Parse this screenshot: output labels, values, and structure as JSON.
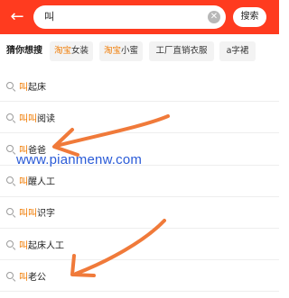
{
  "header": {
    "search_value": "叫",
    "search_button": "搜索",
    "background": "#ff3b1f"
  },
  "guess": {
    "label": "猜你想搜",
    "chips": [
      {
        "brand": "淘宝",
        "rest": "女装"
      },
      {
        "brand": "淘宝",
        "rest": "小蜜"
      },
      {
        "brand": "",
        "rest": "工厂直销衣服"
      },
      {
        "brand": "",
        "rest": "a字裙"
      }
    ]
  },
  "suggestions": [
    {
      "highlight": "叫",
      "rest": "起床"
    },
    {
      "highlight": "叫叫",
      "rest": "阅读"
    },
    {
      "highlight": "叫",
      "rest": "爸爸"
    },
    {
      "highlight": "叫",
      "rest": "醒人工"
    },
    {
      "highlight": "叫叫",
      "rest": "识字"
    },
    {
      "highlight": "叫",
      "rest": "起床人工"
    },
    {
      "highlight": "叫",
      "rest": "老公"
    }
  ],
  "watermark": "www.pianmenw.com",
  "colors": {
    "highlight": "#f07a00",
    "watermark": "#2a5bd7",
    "annotation": "#f07a3a"
  }
}
